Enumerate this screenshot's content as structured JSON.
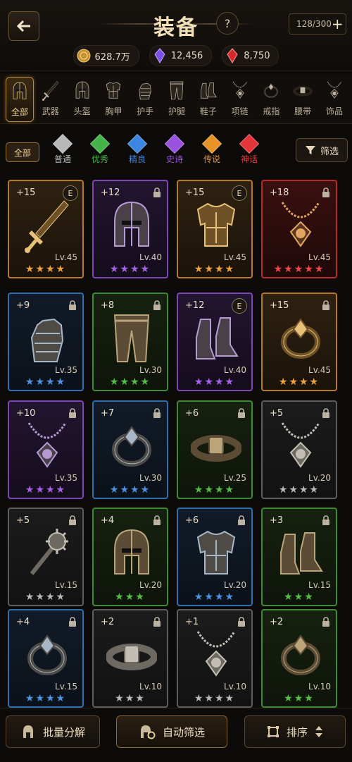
{
  "header": {
    "title": "装备",
    "help": "?",
    "capacity": "128/300",
    "capacity_add": "+"
  },
  "currencies": [
    {
      "icon": "gold-coin-icon",
      "value": "628.7万",
      "color": "#d7a64a"
    },
    {
      "icon": "purple-crystal-icon",
      "value": "12,456",
      "color": "#8a5cf0"
    },
    {
      "icon": "red-crystal-icon",
      "value": "8,750",
      "color": "#e0383a"
    }
  ],
  "categories": [
    {
      "label": "全部",
      "icon": "helmet-all-icon"
    },
    {
      "label": "武器",
      "icon": "sword-icon"
    },
    {
      "label": "头盔",
      "icon": "helmet-icon"
    },
    {
      "label": "胸甲",
      "icon": "chest-armor-icon"
    },
    {
      "label": "护手",
      "icon": "gauntlet-icon"
    },
    {
      "label": "护腿",
      "icon": "leg-armor-icon"
    },
    {
      "label": "鞋子",
      "icon": "boot-icon"
    },
    {
      "label": "项链",
      "icon": "necklace-icon"
    },
    {
      "label": "戒指",
      "icon": "ring-icon"
    },
    {
      "label": "腰带",
      "icon": "belt-icon"
    },
    {
      "label": "饰品",
      "icon": "trinket-icon"
    }
  ],
  "rarity": {
    "all_label": "全部",
    "items": [
      {
        "label": "普通",
        "color": "#b8b8b8"
      },
      {
        "label": "优秀",
        "color": "#44b34a"
      },
      {
        "label": "精良",
        "color": "#3b86e0"
      },
      {
        "label": "史诗",
        "color": "#9b52e0"
      },
      {
        "label": "传说",
        "color": "#e8922a"
      },
      {
        "label": "神话",
        "color": "#e3363a"
      }
    ],
    "filter_label": "筛选"
  },
  "items": [
    {
      "plus": "+15",
      "level": "Lv.45",
      "stars": 4,
      "rarity": "legendary",
      "type": "sword",
      "badge": "E"
    },
    {
      "plus": "+12",
      "level": "Lv.40",
      "stars": 4,
      "rarity": "epic",
      "type": "helmet",
      "badge": "lock"
    },
    {
      "plus": "+15",
      "level": "Lv.45",
      "stars": 4,
      "rarity": "legendary",
      "type": "chest",
      "badge": "E"
    },
    {
      "plus": "+18",
      "level": "Lv.45",
      "stars": 5,
      "rarity": "mythic",
      "type": "necklace",
      "badge": "lock"
    },
    {
      "plus": "+9",
      "level": "Lv.35",
      "stars": 4,
      "rarity": "rare",
      "type": "gauntlet",
      "badge": "lock"
    },
    {
      "plus": "+8",
      "level": "Lv.30",
      "stars": 4,
      "rarity": "uncommon",
      "type": "legs",
      "badge": "lock"
    },
    {
      "plus": "+12",
      "level": "Lv.40",
      "stars": 4,
      "rarity": "epic",
      "type": "boots",
      "badge": "E"
    },
    {
      "plus": "+15",
      "level": "Lv.45",
      "stars": 4,
      "rarity": "legendary",
      "type": "ring",
      "badge": "lock"
    },
    {
      "plus": "+10",
      "level": "Lv.35",
      "stars": 4,
      "rarity": "epic",
      "type": "necklace",
      "badge": "lock"
    },
    {
      "plus": "+7",
      "level": "Lv.30",
      "stars": 4,
      "rarity": "rare",
      "type": "ring",
      "badge": "lock"
    },
    {
      "plus": "+6",
      "level": "Lv.25",
      "stars": 4,
      "rarity": "uncommon",
      "type": "belt",
      "badge": "lock"
    },
    {
      "plus": "+5",
      "level": "Lv.20",
      "stars": 4,
      "rarity": "common",
      "type": "necklace",
      "badge": "lock"
    },
    {
      "plus": "+5",
      "level": "Lv.15",
      "stars": 4,
      "rarity": "common",
      "type": "mace",
      "badge": "lock"
    },
    {
      "plus": "+4",
      "level": "Lv.20",
      "stars": 3,
      "rarity": "uncommon",
      "type": "helmet",
      "badge": "lock"
    },
    {
      "plus": "+6",
      "level": "Lv.20",
      "stars": 4,
      "rarity": "rare",
      "type": "chest",
      "badge": "lock"
    },
    {
      "plus": "+3",
      "level": "Lv.15",
      "stars": 3,
      "rarity": "uncommon",
      "type": "boots",
      "badge": "lock"
    },
    {
      "plus": "+4",
      "level": "Lv.15",
      "stars": 4,
      "rarity": "rare",
      "type": "ring",
      "badge": "lock"
    },
    {
      "plus": "+2",
      "level": "Lv.10",
      "stars": 3,
      "rarity": "common",
      "type": "belt",
      "badge": "lock"
    },
    {
      "plus": "+1",
      "level": "Lv.10",
      "stars": 4,
      "rarity": "common",
      "type": "necklace",
      "badge": "lock"
    },
    {
      "plus": "+2",
      "level": "Lv.10",
      "stars": 3,
      "rarity": "uncommon",
      "type": "ring",
      "badge": "lock"
    }
  ],
  "bottom": {
    "decompose": "批量分解",
    "auto_filter": "自动筛选",
    "sort": "排序"
  }
}
